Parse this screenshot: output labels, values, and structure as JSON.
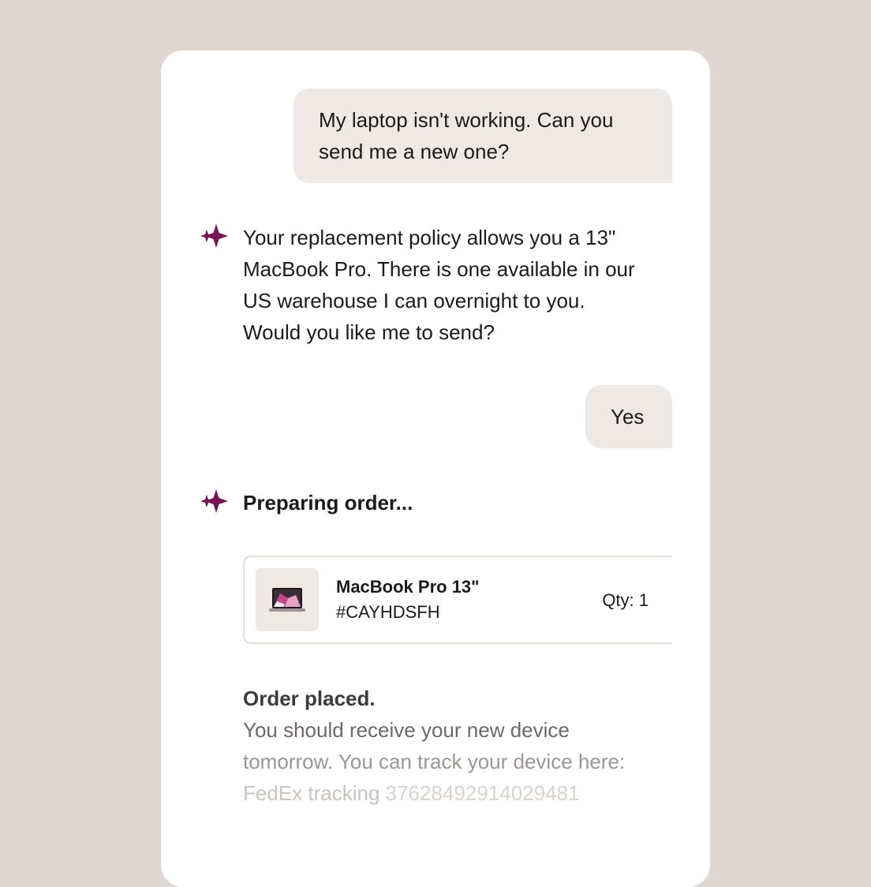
{
  "colors": {
    "background": "#e0d7d2",
    "card": "#ffffff",
    "user_bubble": "#efe9e5",
    "assistant_icon": "#7a1450",
    "text": "#1d1a19"
  },
  "conversation": {
    "user_message_1": {
      "line1": "My laptop isn't working. Can you",
      "line2": "send me a new one?"
    },
    "assistant_message_1": {
      "icon": "sparkle-icon",
      "line1": "Your replacement policy allows you a 13\"",
      "line2": "MacBook Pro. There is one available in our",
      "line3": "US warehouse I can overnight to you.",
      "line4": "Would you like me to send?"
    },
    "user_message_2": {
      "text": "Yes"
    },
    "assistant_message_2": {
      "icon": "sparkle-icon",
      "status": "Preparing order..."
    }
  },
  "order": {
    "product_image": "laptop-image",
    "name": "MacBook Pro 13\"",
    "sku": "#CAYHDSFH",
    "qty": "Qty: 1"
  },
  "confirmation": {
    "title": "Order placed.",
    "line1": "You should receive your new device",
    "line2": "tomorrow. You can track your device here:",
    "tracking_label": "FedEx tracking ",
    "tracking_number": "37628492914029481"
  }
}
